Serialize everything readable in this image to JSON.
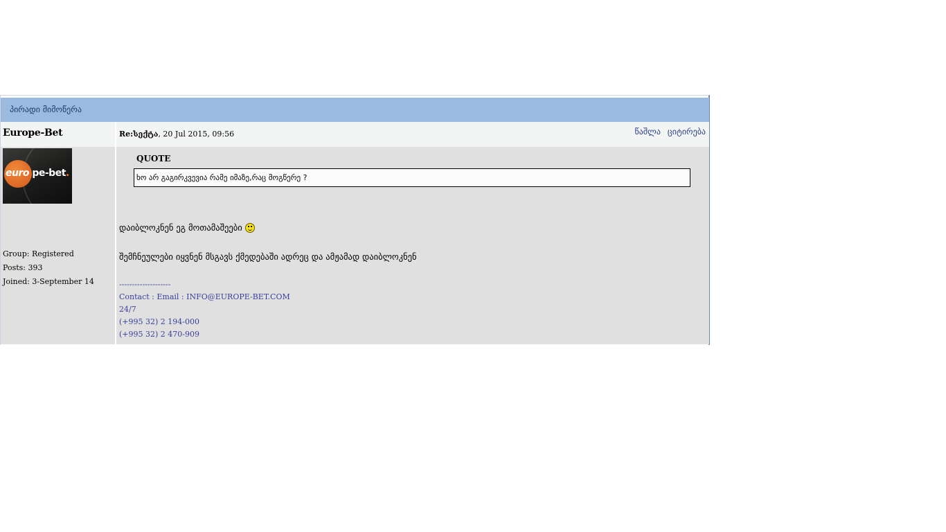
{
  "header": {
    "title": "პირადი მიმოწერა"
  },
  "post": {
    "author": "Europe-Bet",
    "meta_prefix": "Re:სექტა",
    "meta_date": ", 20 Jul 2015, 09:56",
    "actions": {
      "delete_label": "წაშლა",
      "quote_label": "ციტირება"
    },
    "avatar_alt_text": "europe-bet.",
    "user": {
      "group": "Group: Registered",
      "posts": "Posts: 393",
      "joined": "Joined: 3-September 14"
    },
    "quote": {
      "label": "QUOTE",
      "text": "ხო არ გაგირკვევია რამე იმაზე,რაც მოგწერე ?"
    },
    "body": {
      "line1": "დაიბლოკნენ ეგ მოთამაშეები",
      "line1_icon": "smiley-icon",
      "line2": "შემჩნეულები იყვნენ მსგავს ქმედებაში ადრეც და ამჟამად დაიბლოკნენ"
    },
    "signature": {
      "separator": "--------------------",
      "contact": "Contact : Email : INFO@EUROPE-BET.COM",
      "hours": "24/7",
      "phone1": "(+995 32) 2 194-000",
      "phone2": "(+995 32) 2 470-909"
    }
  },
  "colors": {
    "title_bar": "#9bbae0",
    "panel_bg": "#dfe0df",
    "header_row_bg": "#f3f5f4",
    "link": "#2a3f86",
    "signature": "#3a3f9a"
  }
}
